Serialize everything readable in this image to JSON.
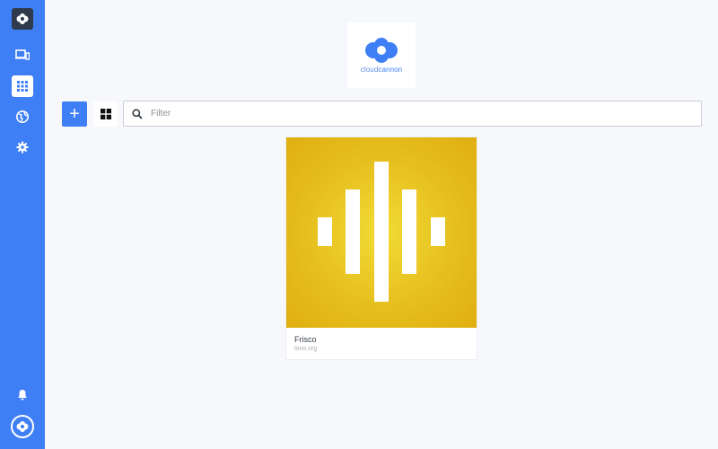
{
  "sidebar": {
    "items": [
      {
        "name": "sites",
        "icon": "devices-icon"
      },
      {
        "name": "apps",
        "icon": "apps-grid-icon",
        "active": true
      },
      {
        "name": "domains",
        "icon": "globe-icon"
      },
      {
        "name": "settings",
        "icon": "gear-icon"
      }
    ],
    "notifications_icon": "bell-icon",
    "avatar_icon": "cloudcannon-eye-icon"
  },
  "org": {
    "logo_text_a": "cloud",
    "logo_text_b": "cannon"
  },
  "toolbar": {
    "add_label": "+",
    "filter_placeholder": "Filter",
    "filter_value": ""
  },
  "sites": [
    {
      "title": "Frisco",
      "domain": "lono.org",
      "thumb_color": "#e6bf1e"
    }
  ],
  "colors": {
    "accent": "#3f7ff6",
    "background": "#f7f8fb"
  }
}
